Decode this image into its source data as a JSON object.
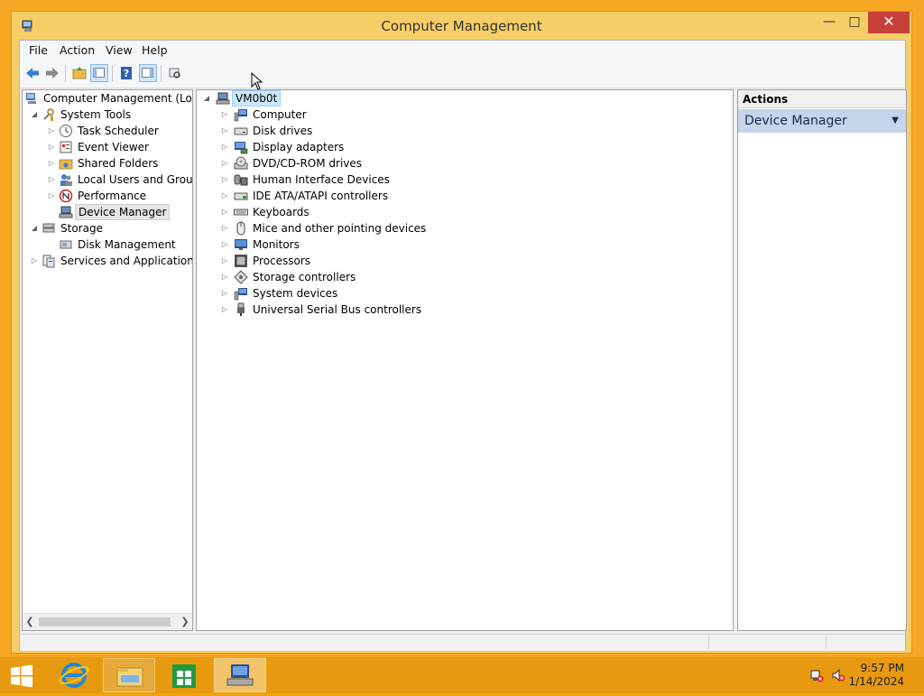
{
  "window": {
    "title": "Computer Management"
  },
  "menu": [
    "File",
    "Action",
    "View",
    "Help"
  ],
  "toolbar": [
    "back",
    "forward",
    "up",
    "show-hide-console-tree",
    "help",
    "show-hide-action-pane",
    "properties"
  ],
  "console_tree": [
    {
      "label": "Computer Management (Local",
      "icon": "computer-management-icon",
      "expanded": true
    },
    {
      "label": "System Tools",
      "icon": "tools-icon",
      "expanded": true
    },
    {
      "label": "Task Scheduler",
      "icon": "clock-icon"
    },
    {
      "label": "Event Viewer",
      "icon": "event-viewer-icon"
    },
    {
      "label": "Shared Folders",
      "icon": "shared-folder-icon"
    },
    {
      "label": "Local Users and Groups",
      "icon": "users-icon"
    },
    {
      "label": "Performance",
      "icon": "performance-icon"
    },
    {
      "label": "Device Manager",
      "icon": "device-manager-icon",
      "selected": true
    },
    {
      "label": "Storage",
      "icon": "storage-icon",
      "expanded": true
    },
    {
      "label": "Disk Management",
      "icon": "disk-management-icon"
    },
    {
      "label": "Services and Applications",
      "icon": "services-icon"
    }
  ],
  "device_tree": {
    "root": "VM0b0t",
    "categories": [
      {
        "label": "Computer",
        "icon": "computer-icon"
      },
      {
        "label": "Disk drives",
        "icon": "disk-drive-icon"
      },
      {
        "label": "Display adapters",
        "icon": "display-adapter-icon"
      },
      {
        "label": "DVD/CD-ROM drives",
        "icon": "dvd-icon"
      },
      {
        "label": "Human Interface Devices",
        "icon": "hid-icon"
      },
      {
        "label": "IDE ATA/ATAPI controllers",
        "icon": "ide-icon"
      },
      {
        "label": "Keyboards",
        "icon": "keyboard-icon"
      },
      {
        "label": "Mice and other pointing devices",
        "icon": "mouse-icon"
      },
      {
        "label": "Monitors",
        "icon": "monitor-icon"
      },
      {
        "label": "Processors",
        "icon": "processor-icon"
      },
      {
        "label": "Storage controllers",
        "icon": "storage-controller-icon"
      },
      {
        "label": "System devices",
        "icon": "system-device-icon"
      },
      {
        "label": "Universal Serial Bus controllers",
        "icon": "usb-icon"
      }
    ]
  },
  "actions": {
    "header": "Actions",
    "item": "Device Manager"
  },
  "taskbar": {
    "apps": [
      "internet-explorer",
      "file-explorer",
      "store",
      "computer-management"
    ],
    "time": "9:57 PM",
    "date": "1/14/2024"
  },
  "colors": {
    "desktop": "#f0a30a",
    "window_frame": "#f6ce67",
    "close": "#c7403a",
    "selection": "#cce8ff"
  }
}
